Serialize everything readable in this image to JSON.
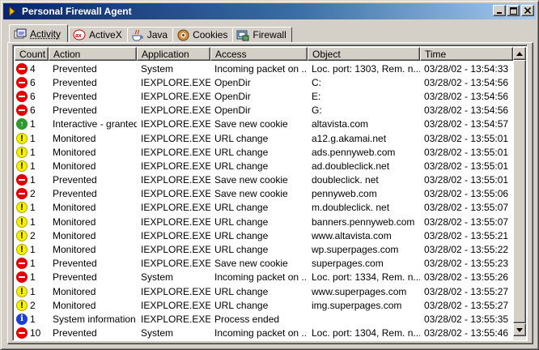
{
  "window": {
    "title": "Personal Firewall Agent",
    "icon": "shield-arrow-icon"
  },
  "tabs": [
    {
      "label": "Activity",
      "icon": "activity-icon",
      "active": true
    },
    {
      "label": "ActiveX",
      "icon": "activex-icon",
      "active": false
    },
    {
      "label": "Java",
      "icon": "java-cup-icon",
      "active": false
    },
    {
      "label": "Cookies",
      "icon": "cookie-icon",
      "active": false
    },
    {
      "label": "Firewall",
      "icon": "firewall-icon",
      "active": false
    }
  ],
  "table": {
    "columns": [
      "Count",
      "Action",
      "Application",
      "Access",
      "Object",
      "Time"
    ],
    "rows": [
      {
        "status": "stop",
        "count": "4",
        "action": "Prevented",
        "application": "System",
        "access": "Incoming packet on ...",
        "object": "Loc. port: 1303, Rem. n...",
        "time": "03/28/02 - 13:54:33"
      },
      {
        "status": "stop",
        "count": "6",
        "action": "Prevented",
        "application": "IEXPLORE.EXE",
        "access": "OpenDir",
        "object": "C:",
        "time": "03/28/02 - 13:54:56"
      },
      {
        "status": "stop",
        "count": "6",
        "action": "Prevented",
        "application": "IEXPLORE.EXE",
        "access": "OpenDir",
        "object": "E:",
        "time": "03/28/02 - 13:54:56"
      },
      {
        "status": "stop",
        "count": "6",
        "action": "Prevented",
        "application": "IEXPLORE.EXE",
        "access": "OpenDir",
        "object": "G:",
        "time": "03/28/02 - 13:54:56"
      },
      {
        "status": "ok",
        "count": "1",
        "action": "Interactive - granted",
        "application": "IEXPLORE.EXE",
        "access": "Save new cookie",
        "object": "altavista.com",
        "time": "03/28/02 - 13:54:57"
      },
      {
        "status": "warn",
        "count": "1",
        "action": "Monitored",
        "application": "IEXPLORE.EXE",
        "access": "URL change",
        "object": "a12.g.akamai.net",
        "time": "03/28/02 - 13:55:01"
      },
      {
        "status": "warn",
        "count": "1",
        "action": "Monitored",
        "application": "IEXPLORE.EXE",
        "access": "URL change",
        "object": "ads.pennyweb.com",
        "time": "03/28/02 - 13:55:01"
      },
      {
        "status": "warn",
        "count": "1",
        "action": "Monitored",
        "application": "IEXPLORE.EXE",
        "access": "URL change",
        "object": "ad.doubleclick.net",
        "time": "03/28/02 - 13:55:01"
      },
      {
        "status": "stop",
        "count": "1",
        "action": "Prevented",
        "application": "IEXPLORE.EXE",
        "access": "Save new cookie",
        "object": "doubleclick. net",
        "time": "03/28/02 - 13:55:01"
      },
      {
        "status": "stop",
        "count": "2",
        "action": "Prevented",
        "application": "IEXPLORE.EXE",
        "access": "Save new cookie",
        "object": "pennyweb.com",
        "time": "03/28/02 - 13:55:06"
      },
      {
        "status": "warn",
        "count": "1",
        "action": "Monitored",
        "application": "IEXPLORE.EXE",
        "access": "URL change",
        "object": "m.doubleclick. net",
        "time": "03/28/02 - 13:55:07"
      },
      {
        "status": "warn",
        "count": "1",
        "action": "Monitored",
        "application": "IEXPLORE.EXE",
        "access": "URL change",
        "object": "banners.pennyweb.com",
        "time": "03/28/02 - 13:55:07"
      },
      {
        "status": "warn",
        "count": "2",
        "action": "Monitored",
        "application": "IEXPLORE.EXE",
        "access": "URL change",
        "object": "www.altavista.com",
        "time": "03/28/02 - 13:55:21"
      },
      {
        "status": "warn",
        "count": "1",
        "action": "Monitored",
        "application": "IEXPLORE.EXE",
        "access": "URL change",
        "object": "wp.superpages.com",
        "time": "03/28/02 - 13:55:22"
      },
      {
        "status": "stop",
        "count": "1",
        "action": "Prevented",
        "application": "IEXPLORE.EXE",
        "access": "Save new cookie",
        "object": "superpages.com",
        "time": "03/28/02 - 13:55:23"
      },
      {
        "status": "stop",
        "count": "1",
        "action": "Prevented",
        "application": "System",
        "access": "Incoming packet on ...",
        "object": "Loc. port: 1334, Rem. n...",
        "time": "03/28/02 - 13:55:26"
      },
      {
        "status": "warn",
        "count": "1",
        "action": "Monitored",
        "application": "IEXPLORE.EXE",
        "access": "URL change",
        "object": "www.superpages.com",
        "time": "03/28/02 - 13:55:27"
      },
      {
        "status": "warn",
        "count": "2",
        "action": "Monitored",
        "application": "IEXPLORE.EXE",
        "access": "URL change",
        "object": "img.superpages.com",
        "time": "03/28/02 - 13:55:27"
      },
      {
        "status": "info",
        "count": "1",
        "action": "System information",
        "application": "IEXPLORE.EXE",
        "access": "Process ended",
        "object": "",
        "time": "03/28/02 - 13:55:35"
      },
      {
        "status": "stop",
        "count": "10",
        "action": "Prevented",
        "application": "System",
        "access": "Incoming packet on ...",
        "object": "Loc. port: 1304, Rem. n...",
        "time": "03/28/02 - 13:55:46"
      }
    ]
  },
  "colors": {
    "titlebar_start": "#0a246a",
    "titlebar_end": "#a6caf0",
    "prevented": "#e00000",
    "monitored": "#f5f000",
    "granted": "#2e9a2e",
    "info": "#1c3fd0"
  }
}
